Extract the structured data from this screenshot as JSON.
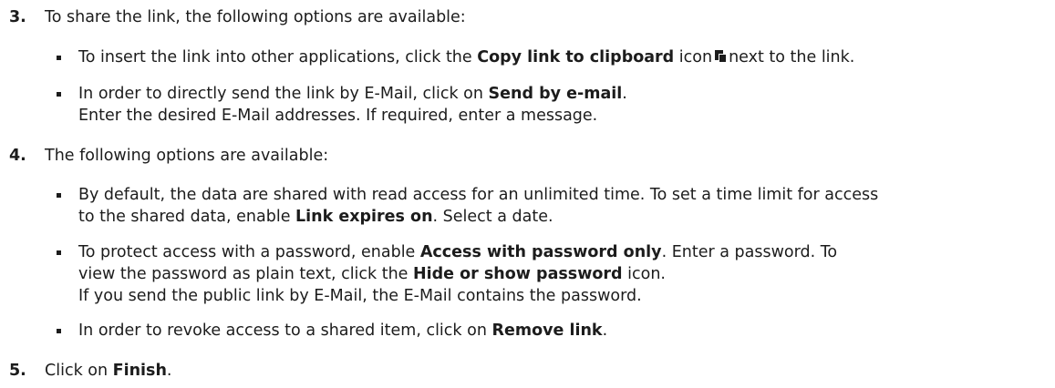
{
  "steps": [
    {
      "number": "3.",
      "text": "To share the link, the following options are available:"
    },
    {
      "number": "4.",
      "text": "The following options are available:"
    },
    {
      "number": "5.",
      "text_pre": "Click on ",
      "bold": "Finish",
      "text_post": "."
    }
  ],
  "step3_bullets": {
    "b1": {
      "pre": "To insert the link into other applications, click the ",
      "bold": "Copy link to clipboard",
      "mid": " icon",
      "icon": "copy-icon",
      "post": "next to the link."
    },
    "b2": {
      "pre": "In order to directly send the link by E-Mail, click on ",
      "bold": "Send by e-mail",
      "post": ".",
      "line2": "Enter the desired E-Mail addresses. If required, enter a message."
    }
  },
  "step4_bullets": {
    "b1": {
      "line1": "By default, the data are shared with read access for an unlimited time. To set a time limit for access",
      "pre2": "to the shared data, enable ",
      "bold": "Link expires on",
      "post2": ". Select a date."
    },
    "b2": {
      "pre1": "To protect access with a password, enable ",
      "bold1": "Access with password only",
      "post1": ". Enter a password. To",
      "pre2": "view the password as plain text, click the ",
      "bold2": "Hide or show password",
      "post2": " icon.",
      "line3": "If you send the public link by E-Mail, the E-Mail contains the password."
    },
    "b3": {
      "pre": "In order to revoke access to a shared item, click on ",
      "bold": "Remove link",
      "post": "."
    }
  }
}
